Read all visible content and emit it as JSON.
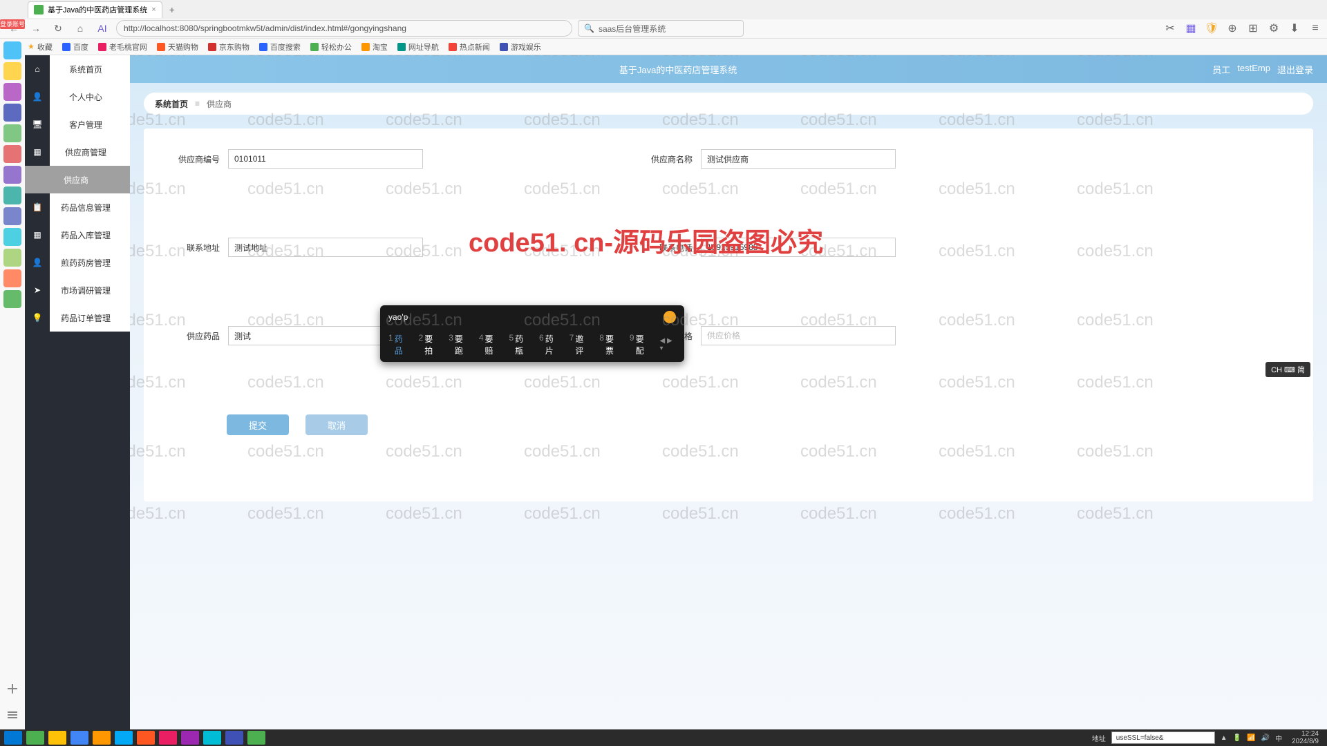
{
  "browser": {
    "tab_title": "基于Java的中医药店管理系统",
    "tab_add": "+",
    "url": "http://localhost:8080/springbootmkw5t/admin/dist/index.html#/gongyingshang",
    "search_placeholder": "saas后台管理系统",
    "login_badge": "登录账号"
  },
  "bookmarks": {
    "fav": "收藏",
    "items": [
      "百度",
      "老毛桃官网",
      "天猫购物",
      "京东购物",
      "百度搜索",
      "轻松办公",
      "淘宝",
      "网址导航",
      "热点新闻",
      "游戏娱乐"
    ]
  },
  "sidebar": {
    "items": [
      {
        "label": "系统首页",
        "light": true
      },
      {
        "label": "个人中心",
        "light": true
      },
      {
        "label": "客户管理",
        "light": true
      },
      {
        "label": "供应商管理",
        "light": true
      },
      {
        "label": "供应商",
        "active": true
      },
      {
        "label": "药品信息管理",
        "light": true
      },
      {
        "label": "药品入库管理",
        "light": true
      },
      {
        "label": "煎药药房管理",
        "light": true
      },
      {
        "label": "市场调研管理",
        "light": true
      },
      {
        "label": "药品订单管理",
        "light": true
      }
    ]
  },
  "header": {
    "title": "基于Java的中医药店管理系统",
    "user_role": "员工",
    "user_name": "testEmp",
    "logout": "退出登录"
  },
  "breadcrumb": {
    "home": "系统首页",
    "current": "供应商"
  },
  "form": {
    "fields": {
      "supplier_code": {
        "label": "供应商编号",
        "value": "0101011"
      },
      "supplier_name": {
        "label": "供应商名称",
        "value": "测试供应商"
      },
      "address": {
        "label": "联系地址",
        "value": "测试地址"
      },
      "phone": {
        "label": "联系电话",
        "value": "15915915988"
      },
      "products": {
        "label": "供应药品",
        "value": "测试"
      },
      "price": {
        "label": "供应价格",
        "value": "",
        "placeholder": "供应价格"
      }
    },
    "submit": "提交",
    "cancel": "取消"
  },
  "ime": {
    "input": "yao'p",
    "candidates": [
      {
        "n": "1",
        "t": "药品"
      },
      {
        "n": "2",
        "t": "要拍"
      },
      {
        "n": "3",
        "t": "要跑"
      },
      {
        "n": "4",
        "t": "要赔"
      },
      {
        "n": "5",
        "t": "药瓶"
      },
      {
        "n": "6",
        "t": "药片"
      },
      {
        "n": "7",
        "t": "邀评"
      },
      {
        "n": "8",
        "t": "要票"
      },
      {
        "n": "9",
        "t": "要配"
      }
    ]
  },
  "ime_indicator": "CH ⌨ 简",
  "watermark": "code51.cn",
  "watermark_big": "code51. cn-源码乐园盗图必究",
  "taskbar": {
    "addr_label": "地址",
    "addr_value": "useSSL=false&",
    "time": "12:24",
    "date": "2024/8/9"
  }
}
